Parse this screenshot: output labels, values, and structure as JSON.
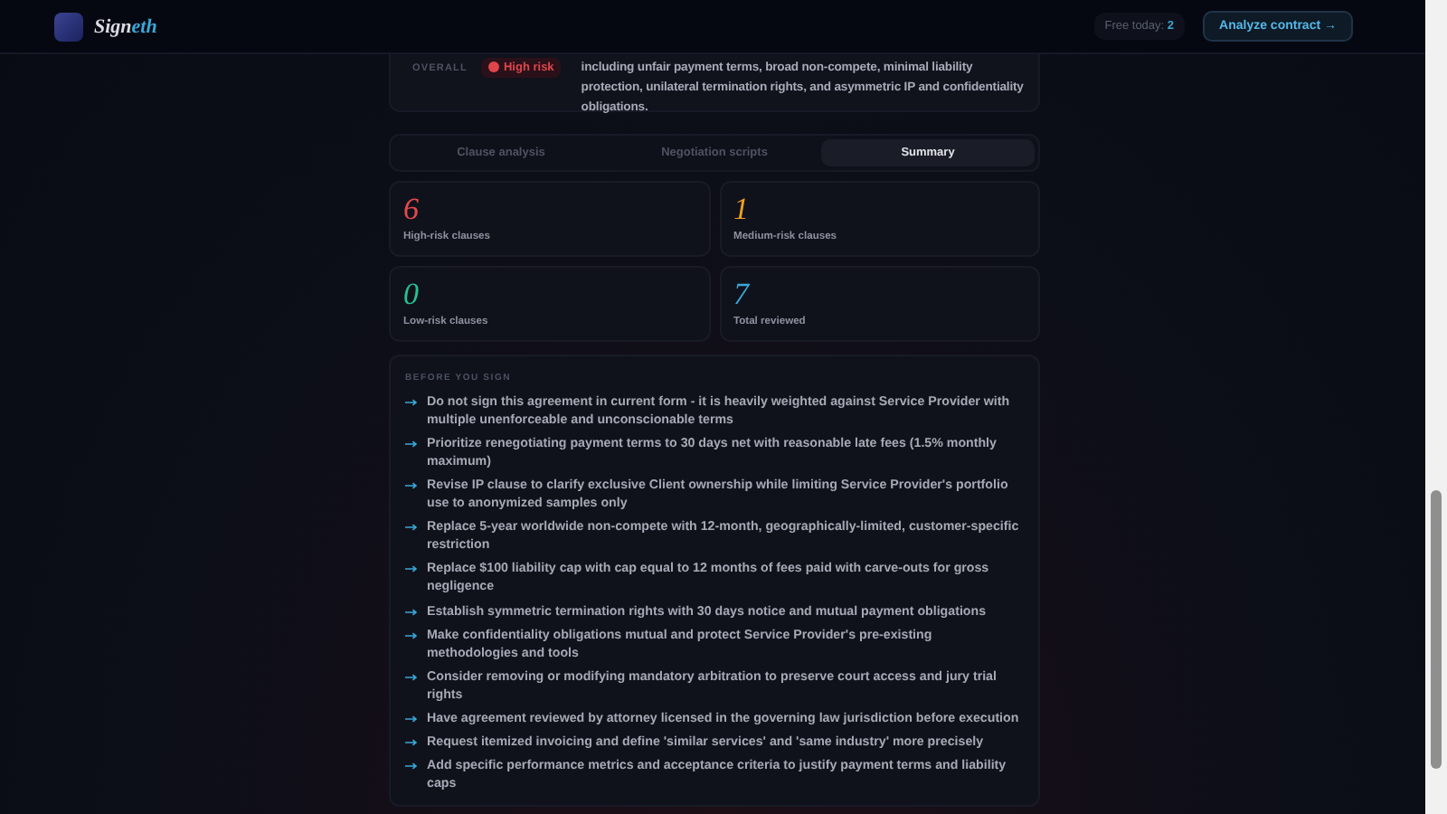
{
  "header": {
    "brand": {
      "lead": "Sign",
      "accent": "eth"
    },
    "free_label": "Free today:",
    "free_count": "2",
    "cta": "Analyze contract →"
  },
  "overall": {
    "label": "OVERALL",
    "risk": "High risk",
    "summary": "including unfair payment terms, broad non-compete, minimal liability protection, unilateral termination rights, and asymmetric IP and confidentiality obligations."
  },
  "tabs": [
    {
      "label": "Clause analysis",
      "selected": false
    },
    {
      "label": "Negotiation scripts",
      "selected": false
    },
    {
      "label": "Summary",
      "selected": true
    }
  ],
  "stats": [
    {
      "value": "6",
      "label": "High-risk clauses",
      "color": "#e5484d"
    },
    {
      "value": "1",
      "label": "Medium-risk clauses",
      "color": "#f0a020"
    },
    {
      "value": "0",
      "label": "Low-risk clauses",
      "color": "#22c38e"
    },
    {
      "value": "7",
      "label": "Total reviewed",
      "color": "#3ba7d8"
    }
  ],
  "before_you_sign": {
    "title": "BEFORE YOU SIGN",
    "items": [
      "Do not sign this agreement in current form - it is heavily weighted against Service Provider with multiple unenforceable and unconscionable terms",
      "Prioritize renegotiating payment terms to 30 days net with reasonable late fees (1.5% monthly maximum)",
      "Revise IP clause to clarify exclusive Client ownership while limiting Service Provider's portfolio use to anonymized samples only",
      "Replace 5-year worldwide non-compete with 12-month, geographically-limited, customer-specific restriction",
      "Replace $100 liability cap with cap equal to 12 months of fees paid with carve-outs for gross negligence",
      "Establish symmetric termination rights with 30 days notice and mutual payment obligations",
      "Make confidentiality obligations mutual and protect Service Provider's pre-existing methodologies and tools",
      "Consider removing or modifying mandatory arbitration to preserve court access and jury trial rights",
      "Have agreement reviewed by attorney licensed in the governing law jurisdiction before execution",
      "Request itemized invoicing and define 'similar services' and 'same industry' more precisely",
      "Add specific performance metrics and acceptance criteria to justify payment terms and liability caps"
    ]
  }
}
